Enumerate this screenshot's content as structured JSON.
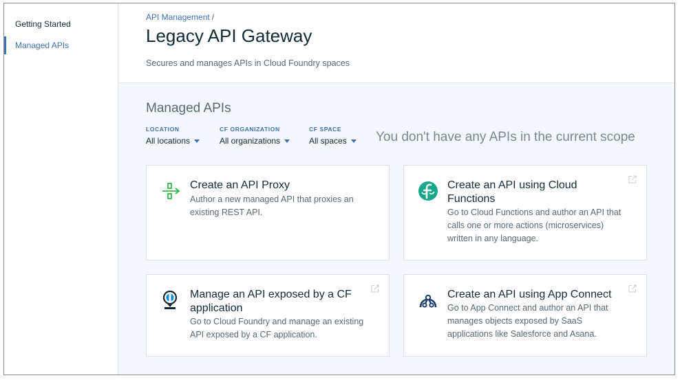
{
  "sidebar": {
    "items": [
      {
        "label": "Getting Started"
      },
      {
        "label": "Managed APIs"
      }
    ]
  },
  "header": {
    "breadcrumb": "API Management",
    "breadcrumb_sep": "/",
    "title": "Legacy API Gateway",
    "description": "Secures and manages APIs in Cloud Foundry spaces"
  },
  "main": {
    "section_title": "Managed APIs",
    "empty_message": "You don't have any APIs in the current scope",
    "filters": [
      {
        "label": "LOCATION",
        "value": "All locations"
      },
      {
        "label": "CF ORGANIZATION",
        "value": "All organizations"
      },
      {
        "label": "CF SPACE",
        "value": "All spaces"
      }
    ],
    "cards": [
      {
        "title": "Create an API Proxy",
        "description": "Author a new managed API that proxies an existing REST API.",
        "icon": "proxy-icon"
      },
      {
        "title": "Create an API using Cloud Functions",
        "description": "Go to Cloud Functions and author an API that calls one or more actions (microservices) written in any language.",
        "icon": "cloud-functions-icon"
      },
      {
        "title": "Manage an API exposed by a CF application",
        "description": "Go to Cloud Foundry and manage an existing API exposed by a CF application.",
        "icon": "cloud-foundry-icon"
      },
      {
        "title": "Create an API using App Connect",
        "description": "Go to App Connect and author an API that manages objects exposed by SaaS applications like Salesforce and Asana.",
        "icon": "app-connect-icon"
      }
    ]
  },
  "colors": {
    "accent": "#3d70b2",
    "proxy_green": "#3ab54a",
    "functions_teal": "#19a78b",
    "main_background": "#f4f7fb"
  }
}
